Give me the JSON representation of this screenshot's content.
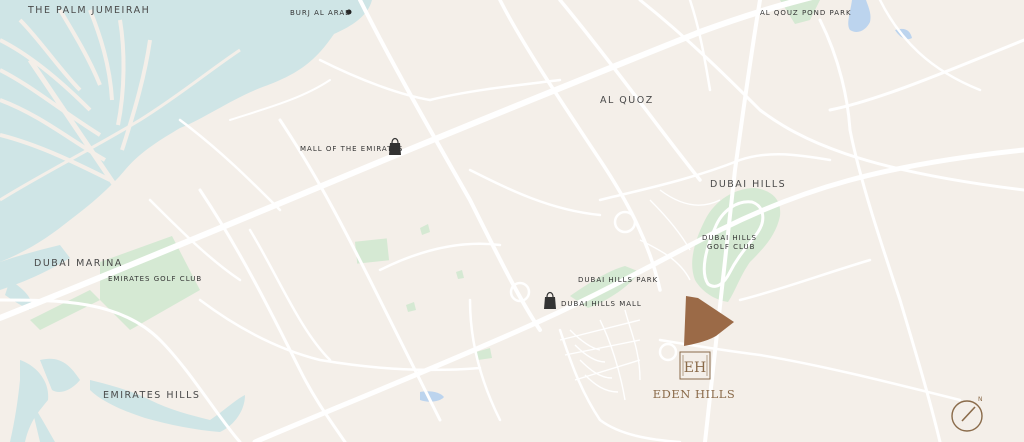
{
  "labels": {
    "palm_jumeirah": "THE PALM JUMEIRAH",
    "burj_al_arab": "BURJ AL ARAB",
    "al_quoz_pond_park": "AL QOUZ POND PARK",
    "al_quoz": "AL QUOZ",
    "mall_of_the_emirates": "MALL OF THE EMIRATES",
    "dubai_hills": "DUBAI HILLS",
    "dubai_hills_golf_club_line1": "DUBAI HILLS",
    "dubai_hills_golf_club_line2": "GOLF CLUB",
    "dubai_marina": "DUBAI MARINA",
    "emirates_golf_club": "EMIRATES GOLF CLUB",
    "dubai_hills_park": "DUBAI HILLS PARK",
    "dubai_hills_mall": "DUBAI HILLS MALL",
    "emirates_hills": "EMIRATES HILLS"
  },
  "brand": {
    "monogram": "EH",
    "name": "EDEN HILLS"
  },
  "compass": {
    "north": "N"
  },
  "colors": {
    "land": "#f4efe9",
    "water": "#cfe5e6",
    "park": "#d5e9d3",
    "road": "#ffffff",
    "plot": "#9b6a47",
    "brand": "#8a6b4a",
    "lake": "#bcd4ee"
  }
}
